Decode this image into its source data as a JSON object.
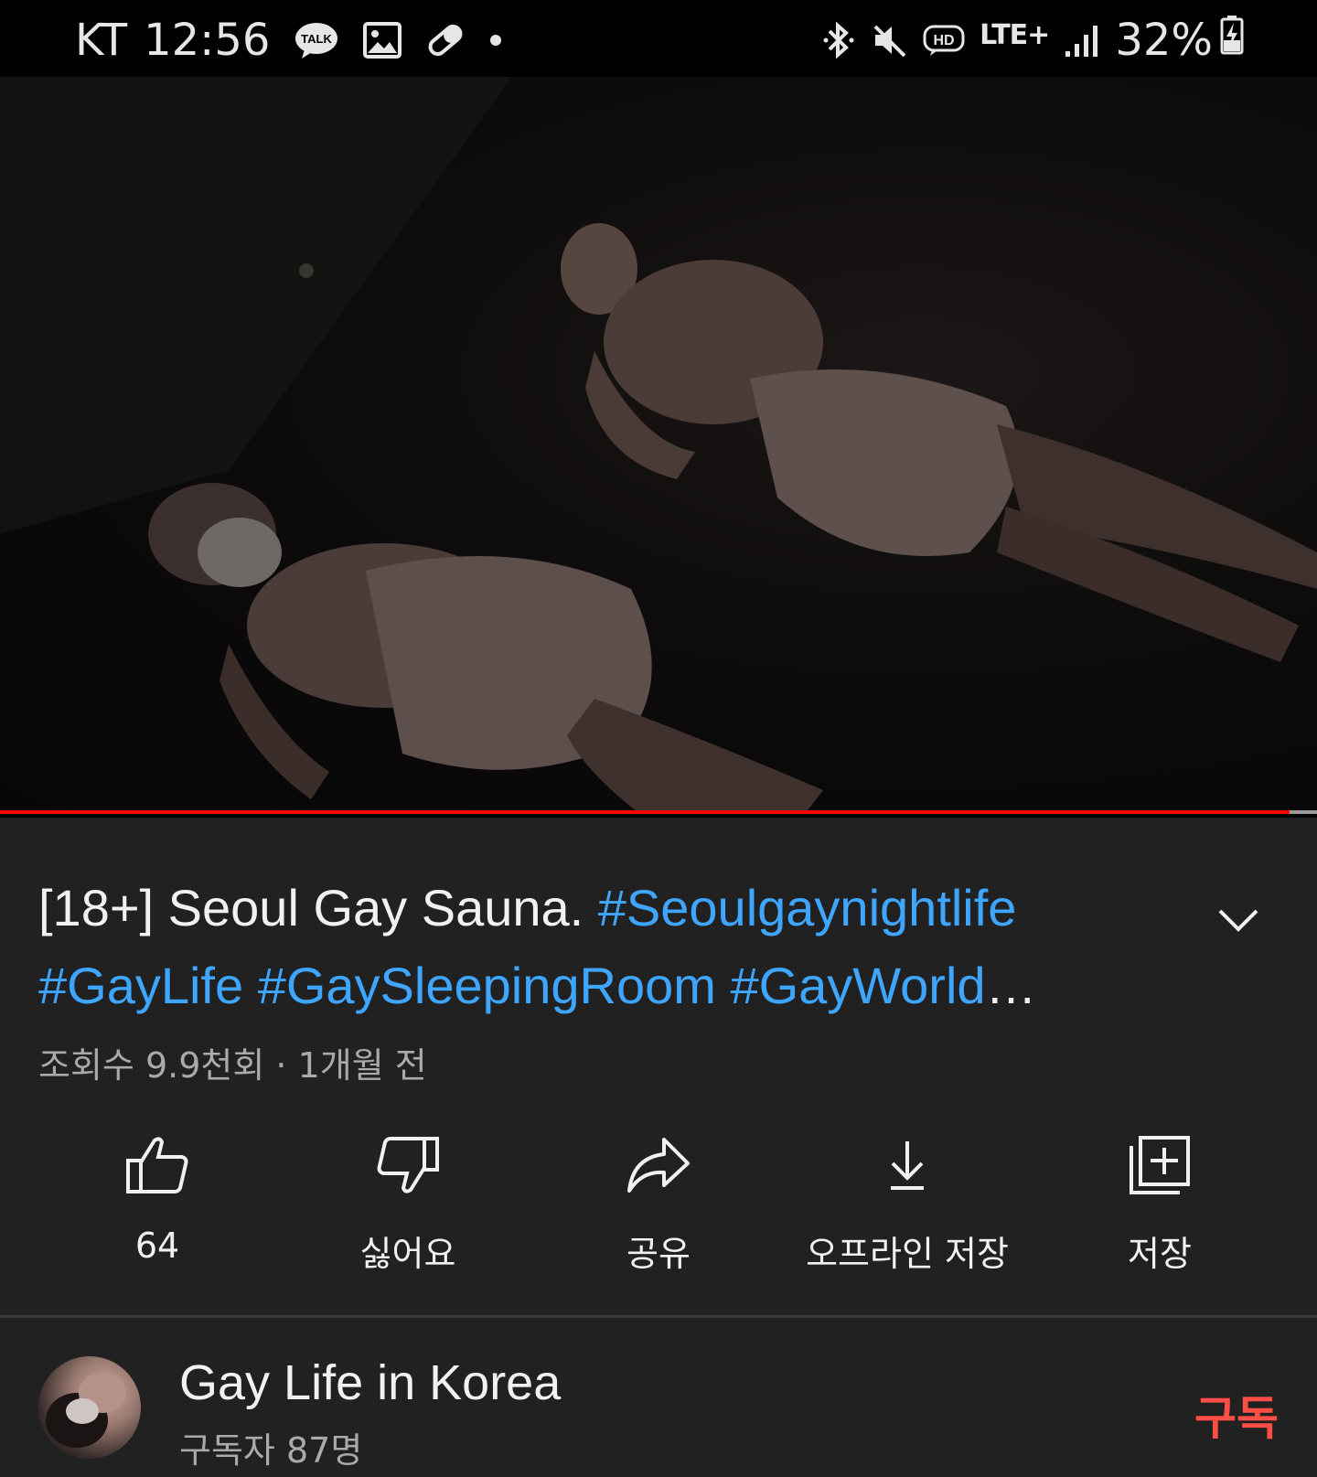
{
  "status_bar": {
    "carrier": "KT",
    "time": "12:56",
    "talk_badge": "TALK",
    "network": "LTE+",
    "hd_badge": "HD",
    "battery": "32%",
    "icons": [
      "kakaotalk-icon",
      "image-icon",
      "pill-icon",
      "dot-icon",
      "bluetooth-icon",
      "mute-icon",
      "hd-voice-icon",
      "lte-icon",
      "signal-icon",
      "battery-charging-icon"
    ]
  },
  "player": {
    "progress": 0.979,
    "progress_color": "#ff0000",
    "track_color": "#9a9a9a"
  },
  "video": {
    "title_prefix": "[18+] Seoul Gay Sauna.",
    "title_tags": [
      "#Seoulgaynightlife",
      "#GayLife",
      "#GaySleepingRoom",
      "#GayWorld"
    ],
    "title_ellipsis": "…",
    "tag_color": "#3ea6ff",
    "views": "조회수 9.9천회",
    "meta_separator": "·",
    "age": "1개월 전"
  },
  "actions": [
    {
      "icon": "thumbs-up-icon",
      "label": "64"
    },
    {
      "icon": "thumbs-down-icon",
      "label": "싫어요"
    },
    {
      "icon": "share-icon",
      "label": "공유"
    },
    {
      "icon": "download-icon",
      "label": "오프라인 저장"
    },
    {
      "icon": "add-to-playlist-icon",
      "label": "저장"
    }
  ],
  "channel": {
    "name": "Gay Life in Korea",
    "subscribers": "구독자 87명",
    "subscribe_label": "구독",
    "subscribe_color": "#ff4e45"
  }
}
